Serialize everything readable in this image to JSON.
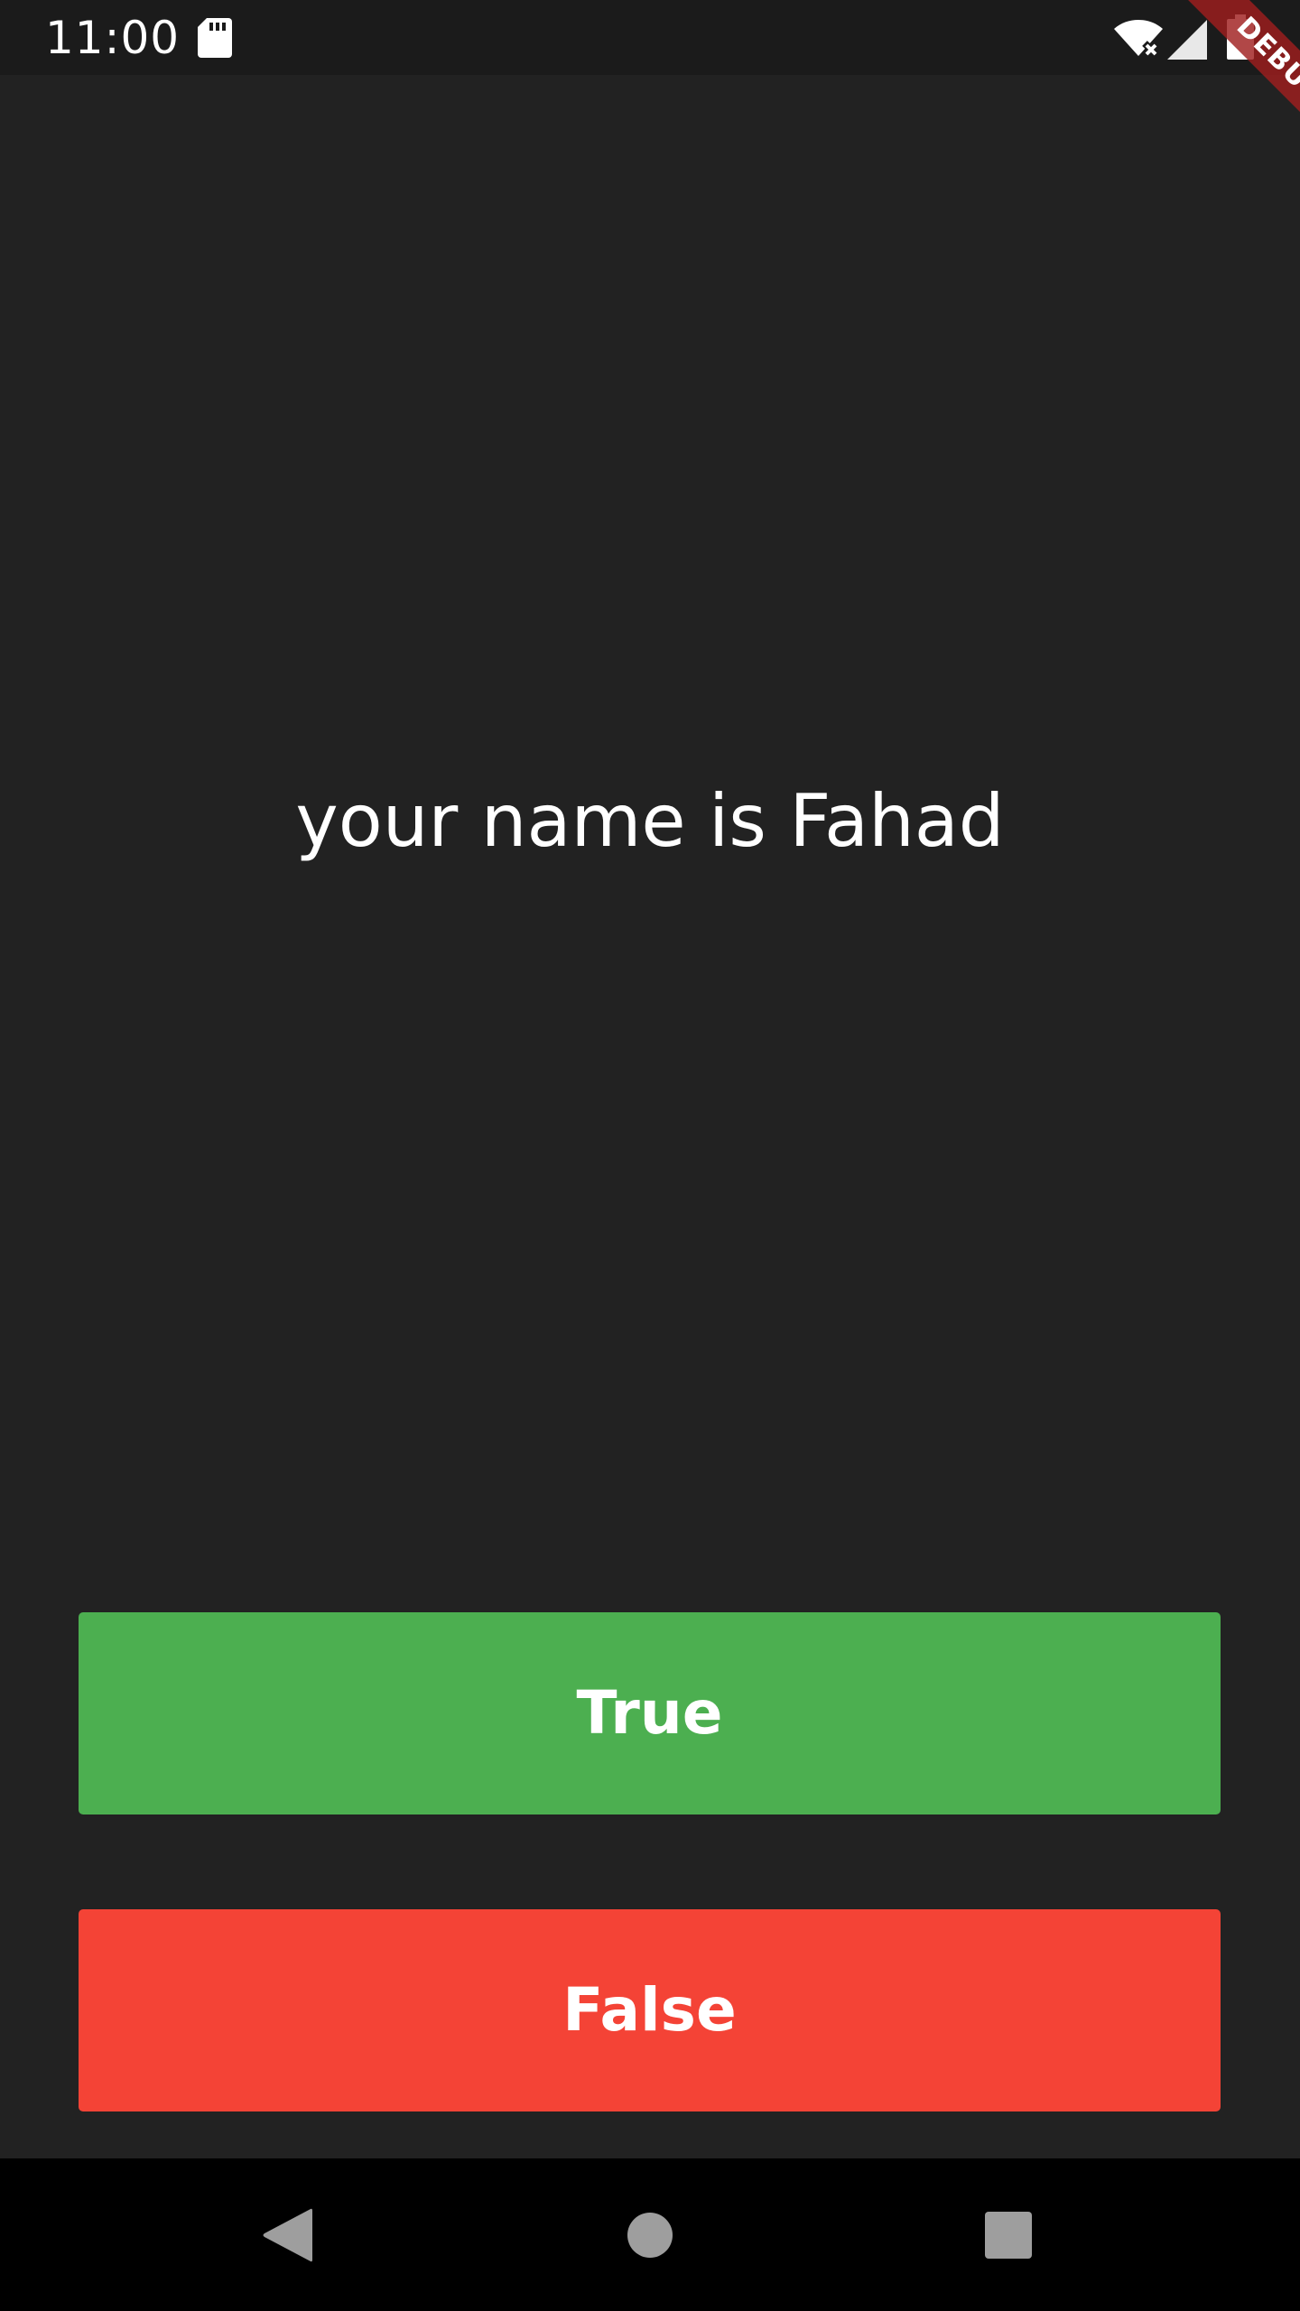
{
  "status_bar": {
    "time": "11:00",
    "icons": [
      "sd-card-icon",
      "wifi-off-icon",
      "signal-icon",
      "battery-icon"
    ]
  },
  "debug_banner": {
    "label": "DEBUG",
    "color": "#a01e1e"
  },
  "quiz": {
    "question": "your name is Fahad",
    "true_label": "True",
    "false_label": "False"
  },
  "colors": {
    "background": "#222222",
    "true_button": "#4caf50",
    "false_button": "#f44336",
    "nav_bar": "#000000",
    "nav_icon": "#9e9e9e"
  },
  "nav_bar": {
    "icons": [
      "back-icon",
      "home-icon",
      "recents-icon"
    ]
  }
}
